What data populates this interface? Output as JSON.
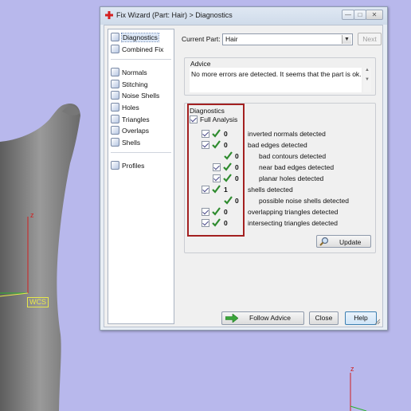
{
  "window": {
    "title": "Fix Wizard (Part: Hair) > Diagnostics",
    "min_glyph": "—",
    "max_glyph": "□",
    "close_glyph": "✕"
  },
  "sidebar": {
    "top_items": [
      {
        "label": "Diagnostics",
        "icon": "diagnostics-icon",
        "active": true
      },
      {
        "label": "Combined Fix",
        "icon": "combined-fix-icon"
      }
    ],
    "fix_items": [
      {
        "label": "Normals",
        "icon": "normals-icon"
      },
      {
        "label": "Stitching",
        "icon": "stitching-icon"
      },
      {
        "label": "Noise Shells",
        "icon": "noise-shells-icon"
      },
      {
        "label": "Holes",
        "icon": "holes-icon"
      },
      {
        "label": "Triangles",
        "icon": "triangles-icon"
      },
      {
        "label": "Overlaps",
        "icon": "overlaps-icon"
      },
      {
        "label": "Shells",
        "icon": "shells-icon"
      }
    ],
    "bottom_items": [
      {
        "label": "Profiles",
        "icon": "profiles-icon"
      }
    ]
  },
  "part": {
    "label": "Current Part:",
    "value": "Hair",
    "next_label": "Next"
  },
  "advice": {
    "title": "Advice",
    "text": "No more errors are detected. It seems that the part is ok."
  },
  "diagnostics": {
    "title": "Diagnostics",
    "full_analysis_label": "Full Analysis",
    "rows": [
      {
        "checkbox": true,
        "count": "0",
        "label": "inverted normals detected",
        "indent": 0
      },
      {
        "checkbox": true,
        "count": "0",
        "label": "bad edges detected",
        "indent": 0
      },
      {
        "checkbox": false,
        "count": "0",
        "label": "bad contours detected",
        "indent": 2
      },
      {
        "checkbox": true,
        "count": "0",
        "label": "near bad edges detected",
        "indent": 1
      },
      {
        "checkbox": true,
        "count": "0",
        "label": "planar holes detected",
        "indent": 1
      },
      {
        "checkbox": true,
        "count": "1",
        "label": "shells detected",
        "indent": 0
      },
      {
        "checkbox": false,
        "count": "0",
        "label": "possible noise shells detected",
        "indent": 2
      },
      {
        "checkbox": true,
        "count": "0",
        "label": "overlapping triangles detected",
        "indent": 0
      },
      {
        "checkbox": true,
        "count": "0",
        "label": "intersecting triangles detected",
        "indent": 0
      }
    ],
    "update_label": "Update"
  },
  "buttons": {
    "follow_advice": "Follow Advice",
    "close": "Close",
    "help": "Help"
  },
  "viewport": {
    "wcs_label": "WCS",
    "axis_z": "z"
  },
  "colors": {
    "viewport_bg": "#b8b8ec",
    "highlight_border": "#a32020",
    "tick_green": "#2e8b2e"
  }
}
